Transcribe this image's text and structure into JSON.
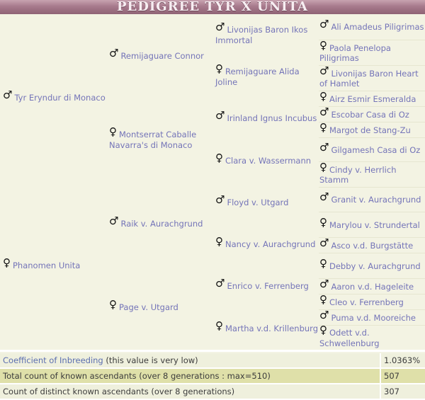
{
  "title": "PEDIGREE TYR X UNITA",
  "pedigree": {
    "gen1": [
      {
        "sex": "male",
        "name": "Tyr Eryndur di Monaco"
      },
      {
        "sex": "female",
        "name": "Phanomen Unita"
      }
    ],
    "gen2": [
      {
        "sex": "male",
        "name": "Remijaguare Connor"
      },
      {
        "sex": "female",
        "name": "Montserrat Caballe Navarra's di Monaco"
      },
      {
        "sex": "male",
        "name": "Raik v. Aurachgrund"
      },
      {
        "sex": "female",
        "name": "Page v. Utgard"
      }
    ],
    "gen3": [
      {
        "sex": "male",
        "name": "Livonijas Baron Ikos Immortal"
      },
      {
        "sex": "female",
        "name": "Remijaguare Alida Joline"
      },
      {
        "sex": "male",
        "name": "Irinland Ignus Incubus"
      },
      {
        "sex": "female",
        "name": "Clara v. Wassermann"
      },
      {
        "sex": "male",
        "name": "Floyd v. Utgard"
      },
      {
        "sex": "female",
        "name": "Nancy v. Aurachgrund"
      },
      {
        "sex": "male",
        "name": "Enrico v. Ferrenberg"
      },
      {
        "sex": "female",
        "name": "Martha v.d. Krillenburg"
      }
    ],
    "gen4": [
      {
        "sex": "male",
        "name": "Ali Amadeus Piligrimas"
      },
      {
        "sex": "female",
        "name": "Paola Penelopa Piligrimas"
      },
      {
        "sex": "male",
        "name": "Livonijas Baron Heart of Hamlet"
      },
      {
        "sex": "female",
        "name": "Airz Esmir Esmeralda"
      },
      {
        "sex": "male",
        "name": "Escobar Casa di Oz"
      },
      {
        "sex": "female",
        "name": "Margot de Stang-Zu"
      },
      {
        "sex": "male",
        "name": "Gilgamesh Casa di Oz"
      },
      {
        "sex": "female",
        "name": "Cindy v. Herrlich Stamm"
      },
      {
        "sex": "male",
        "name": "Granit v. Aurachgrund"
      },
      {
        "sex": "female",
        "name": "Marylou v. Strundertal"
      },
      {
        "sex": "male",
        "name": "Asco v.d. Burgstätte"
      },
      {
        "sex": "female",
        "name": "Debby v. Aurachgrund"
      },
      {
        "sex": "male",
        "name": "Aaron v.d. Hageleite"
      },
      {
        "sex": "female",
        "name": "Cleo v. Ferrenberg"
      },
      {
        "sex": "male",
        "name": "Puma v.d. Mooreiche"
      },
      {
        "sex": "female",
        "name": "Odett v.d. Schwellenburg"
      }
    ]
  },
  "symbols": {
    "male": "♂",
    "female": "♀"
  },
  "stats": {
    "coi_link": "Coefficient of Inbreeding",
    "coi_note": " (this value is very low)",
    "coi_value": "1.0363%",
    "total_label": "Total count of known ascendants (over 8 generations : max=510)",
    "total_value": "507",
    "distinct_label": "Count of distinct known ascendants (over 8 generations)",
    "distinct_value": "307"
  },
  "colors": {
    "link": "#7474b8",
    "banner": "#a77a8c",
    "highlight_row": "#dfe0a9"
  }
}
